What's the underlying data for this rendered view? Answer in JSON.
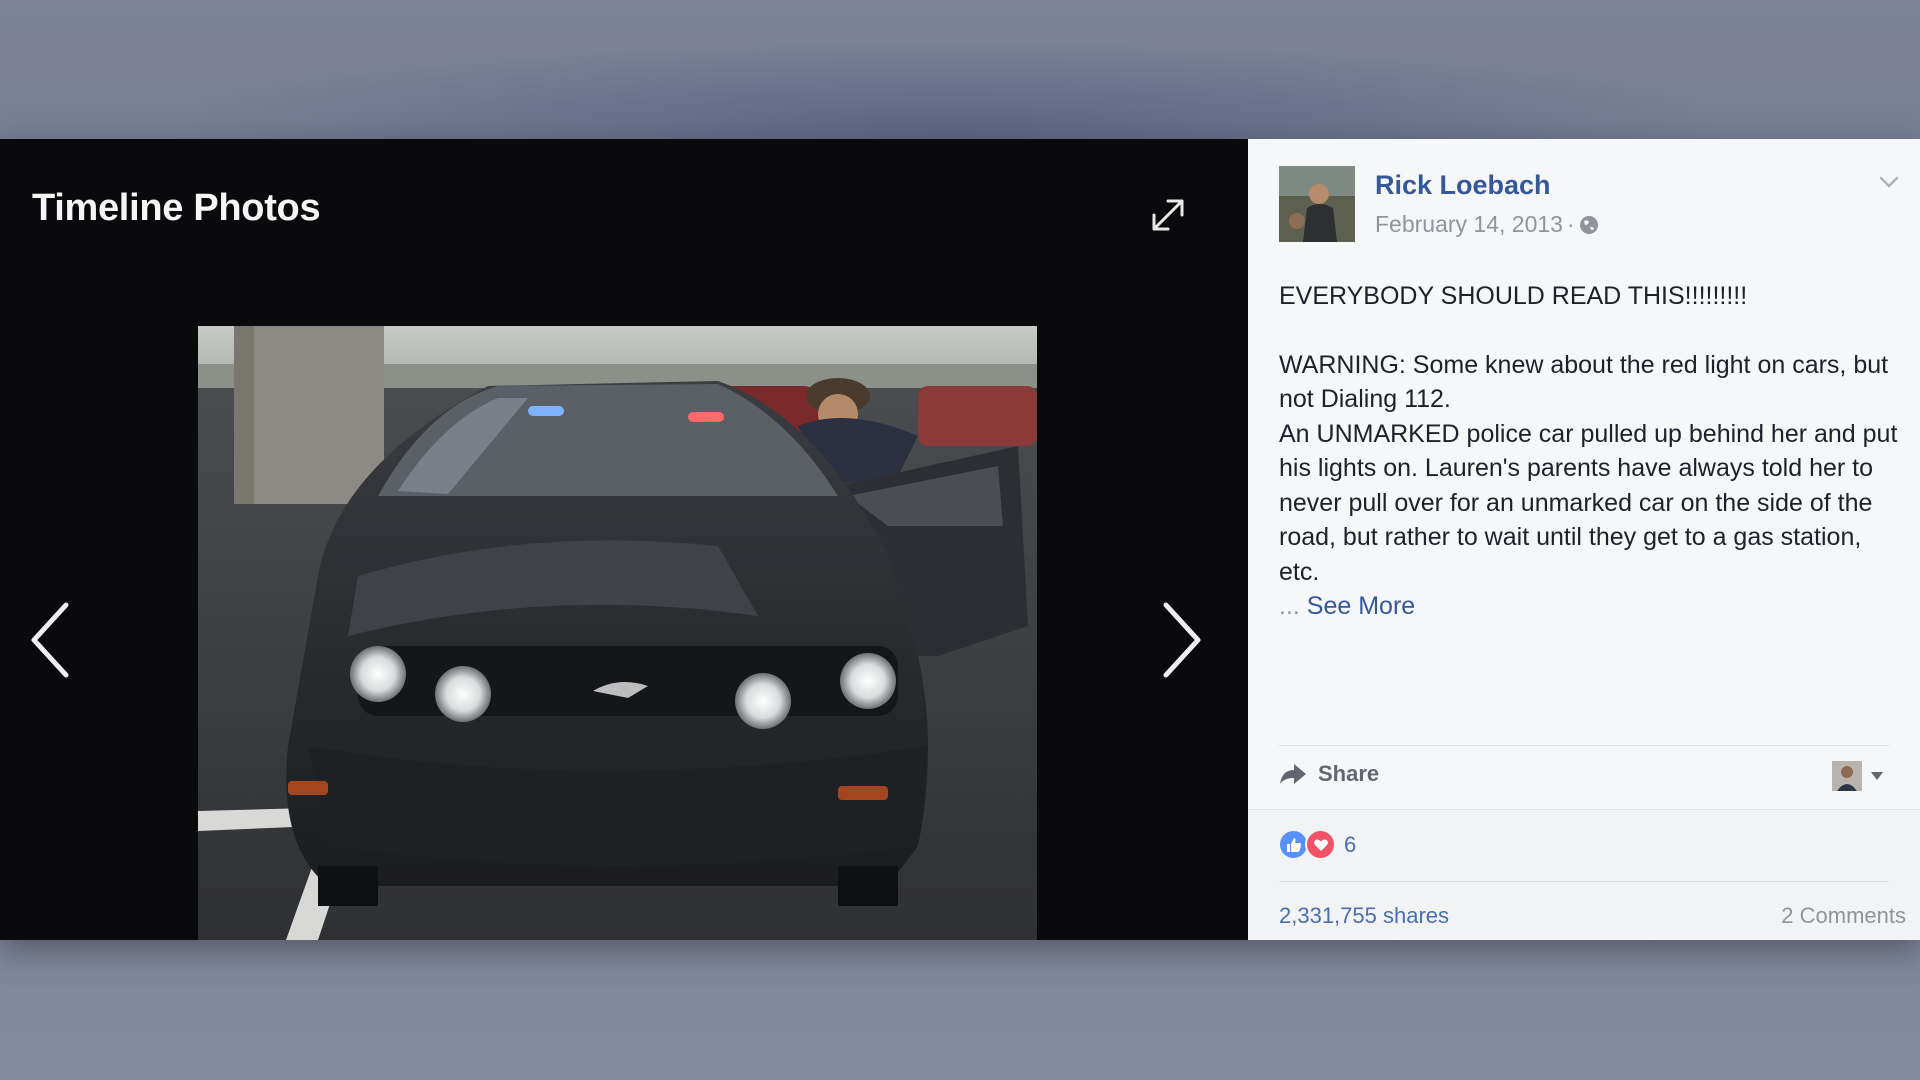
{
  "viewer": {
    "title": "Timeline Photos"
  },
  "post": {
    "author": "Rick Loebach",
    "date": "February 14, 2013",
    "separator": "·",
    "privacy_icon": "globe-icon",
    "headline": "EVERYBODY SHOULD READ THIS!!!!!!!!!",
    "paragraph_1": "WARNING: Some knew about the red light on cars, but not Dialing 112.",
    "paragraph_2": "An UNMARKED police car pulled up behind her and put his lights on. Lauren's parents have always told her to never pull over for an unmarked car on the side of the road, but rather to wait until they get to a gas station, etc.",
    "ellipsis": "...",
    "see_more": "See More"
  },
  "actions": {
    "share_label": "Share"
  },
  "stats": {
    "reaction_count": "6",
    "shares": "2,331,755 shares",
    "comments": "2 Comments"
  },
  "colors": {
    "link": "#365899",
    "like": "#5890ff",
    "love": "#f25268"
  }
}
